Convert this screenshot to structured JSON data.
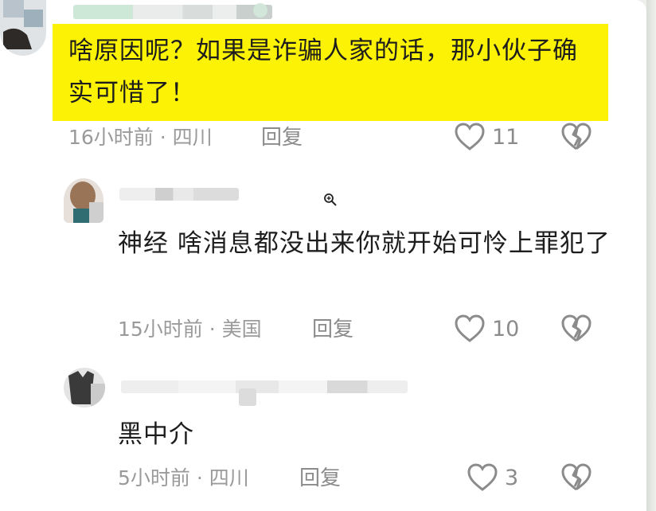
{
  "comments": [
    {
      "text": "啥原因呢？如果是诈骗人家的话，那小伙子确实可惜了！",
      "time_location": "16小时前 · 四川",
      "reply_label": "回复",
      "likes": "11",
      "highlighted": true
    },
    {
      "text": "神经 啥消息都没出来你就开始可怜上罪犯了",
      "time_location": "15小时前 · 美国",
      "reply_label": "回复",
      "likes": "10",
      "highlighted": false
    },
    {
      "text": "黑中介",
      "time_location": "5小时前 · 四川",
      "reply_label": "回复",
      "likes": "3",
      "highlighted": false
    }
  ],
  "icons": {
    "like": "heart-icon",
    "dislike": "broken-heart-icon",
    "zoom": "zoom-in-icon"
  },
  "colors": {
    "highlight": "#fbf205",
    "text": "#1d1d1d",
    "meta": "#9a9a9a"
  }
}
